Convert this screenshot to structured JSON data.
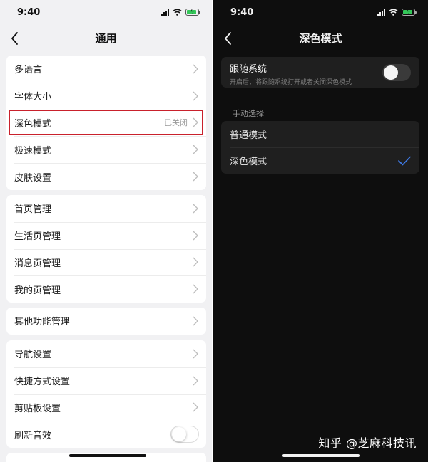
{
  "left_screen": {
    "status_time": "9:40",
    "title": "通用",
    "groups": [
      {
        "items": [
          {
            "label": "多语言",
            "value": ""
          },
          {
            "label": "字体大小",
            "value": ""
          },
          {
            "label": "深色模式",
            "value": "已关闭"
          },
          {
            "label": "极速模式",
            "value": ""
          },
          {
            "label": "皮肤设置",
            "value": ""
          }
        ]
      },
      {
        "items": [
          {
            "label": "首页管理"
          },
          {
            "label": "生活页管理"
          },
          {
            "label": "消息页管理"
          },
          {
            "label": "我的页管理"
          }
        ]
      },
      {
        "items": [
          {
            "label": "其他功能管理"
          }
        ]
      },
      {
        "items": [
          {
            "label": "导航设置"
          },
          {
            "label": "快捷方式设置"
          },
          {
            "label": "剪贴板设置"
          },
          {
            "label": "刷新音效",
            "toggle": false
          }
        ]
      }
    ]
  },
  "right_screen": {
    "status_time": "9:40",
    "title": "深色模式",
    "follow_system": {
      "title": "跟随系统",
      "subtitle": "开启后，将跟随系统打开或者关闭深色模式",
      "enabled": false
    },
    "manual_label": "手动选择",
    "modes": [
      {
        "label": "普通模式",
        "selected": false
      },
      {
        "label": "深色模式",
        "selected": true
      }
    ]
  },
  "watermark": "知乎 @芝麻科技讯",
  "colors": {
    "highlight_border": "#c9212c",
    "check_blue": "#3f7be8",
    "battery_green": "#34c759"
  }
}
